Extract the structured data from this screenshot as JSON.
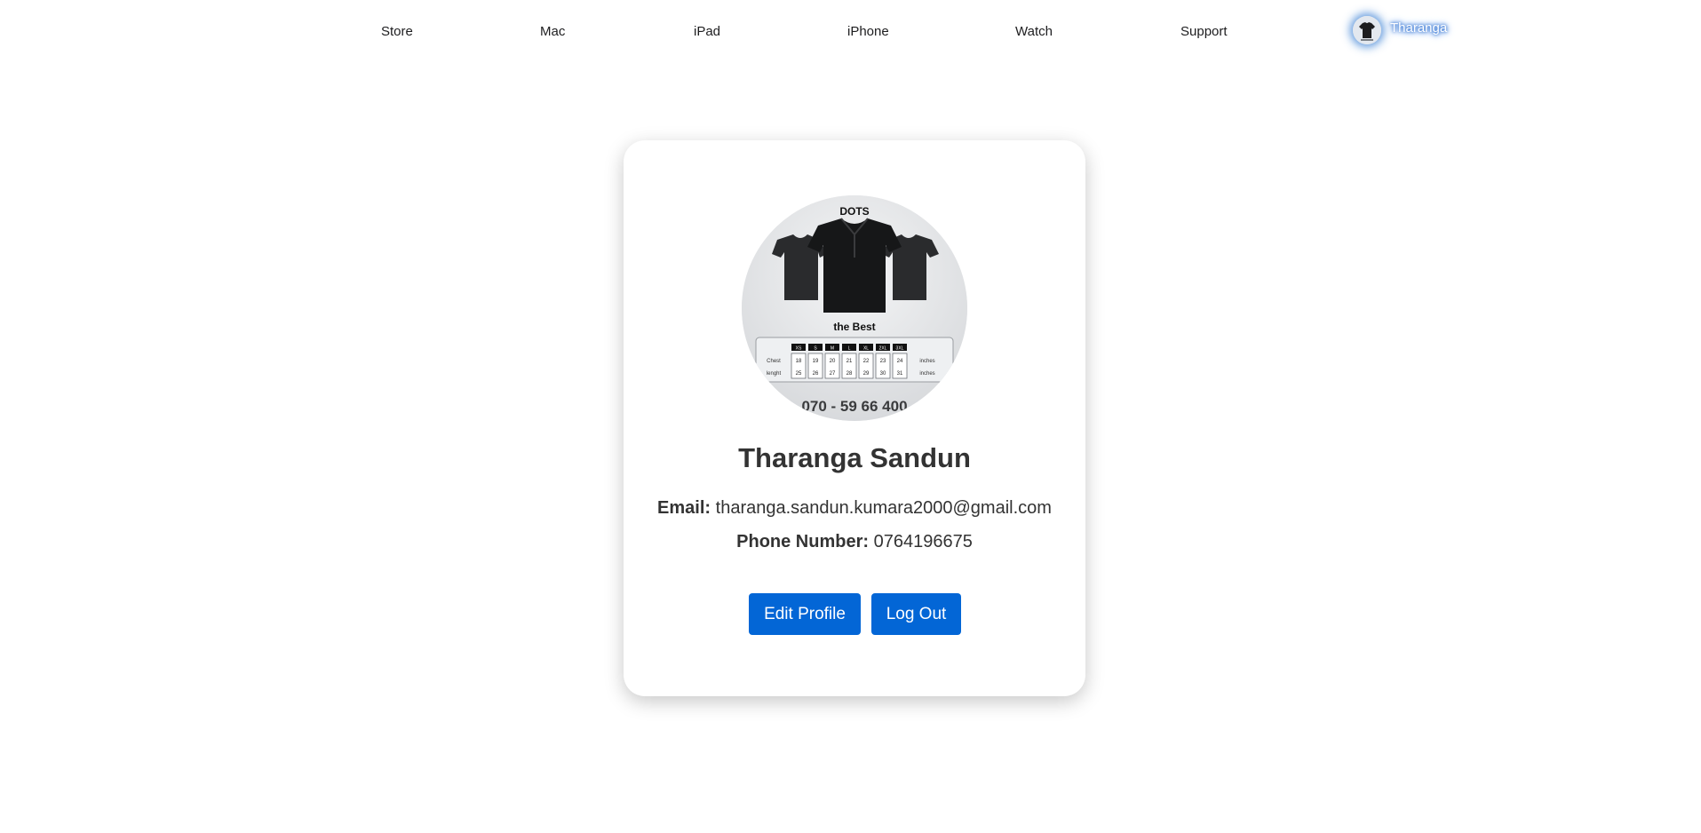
{
  "nav": {
    "items": [
      {
        "label": "Store"
      },
      {
        "label": "Mac"
      },
      {
        "label": "iPad"
      },
      {
        "label": "iPhone"
      },
      {
        "label": "Watch"
      },
      {
        "label": "Support"
      }
    ],
    "user": {
      "name": "Tharanga",
      "avatar_icon": "tshirt-avatar-icon"
    }
  },
  "profile": {
    "name": "Tharanga Sandun",
    "email_label": "Email:",
    "email": "tharanga.sandun.kumara2000@gmail.com",
    "phone_label": "Phone Number:",
    "phone": "0764196675",
    "photo": {
      "brand": "DOTS",
      "tagline": "the Best",
      "sizes": [
        "XS",
        "S",
        "M",
        "L",
        "XL",
        "2XL",
        "3XL"
      ],
      "row_labels": [
        "Chest",
        "lenght"
      ],
      "units": "inches",
      "chest": [
        "18",
        "19",
        "20",
        "21",
        "22",
        "23",
        "24"
      ],
      "length": [
        "25",
        "26",
        "27",
        "28",
        "29",
        "30",
        "31"
      ],
      "phone": "070 - 59 66 400"
    }
  },
  "actions": {
    "edit_label": "Edit Profile",
    "logout_label": "Log Out"
  },
  "colors": {
    "primary_button": "#0366d6",
    "user_glow": "#2d6fd2",
    "text": "#333333"
  }
}
